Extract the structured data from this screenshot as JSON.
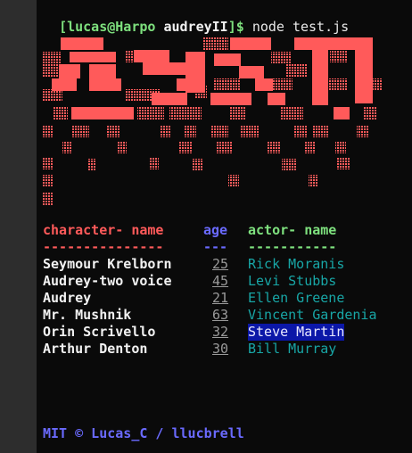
{
  "prompt": {
    "open_bracket": "[",
    "user_host": "lucas@Harpo",
    "dir": "audreyII",
    "close": "]$",
    "command": "node test.js"
  },
  "banner_art": "ASCII block-art logo (red pattern)",
  "table": {
    "headers": {
      "character": "character- name",
      "age": "age",
      "actor": "actor- name"
    },
    "rules": {
      "character": "---------------",
      "age": "---",
      "actor": "-----------"
    },
    "rows": [
      {
        "character": "Seymour Krelborn",
        "age": "25",
        "actor": "Rick Moranis"
      },
      {
        "character": "Audrey-two voice",
        "age": "45",
        "actor": "Levi Stubbs"
      },
      {
        "character": "Audrey",
        "age": "21",
        "actor": "Ellen Greene"
      },
      {
        "character": "Mr. Mushnik",
        "age": "63",
        "actor": "Vincent Gardenia"
      },
      {
        "character": "Orin Scrivello",
        "age": "32",
        "actor": "Steve Martin"
      },
      {
        "character": "Arthur Denton",
        "age": "30",
        "actor": "Bill Murray"
      }
    ],
    "selected_actor_row": 4
  },
  "footer": "MIT © Lucas_C / llucbrell",
  "colors": {
    "terminal_bg": "#0a0a0a",
    "banner_red": "#ff5a5a",
    "header_red": "#ff5a5a",
    "header_blue": "#6a6aff",
    "header_green": "#7ee07e",
    "actor_teal": "#18a6a6",
    "selection_bg": "#0b17a8"
  }
}
